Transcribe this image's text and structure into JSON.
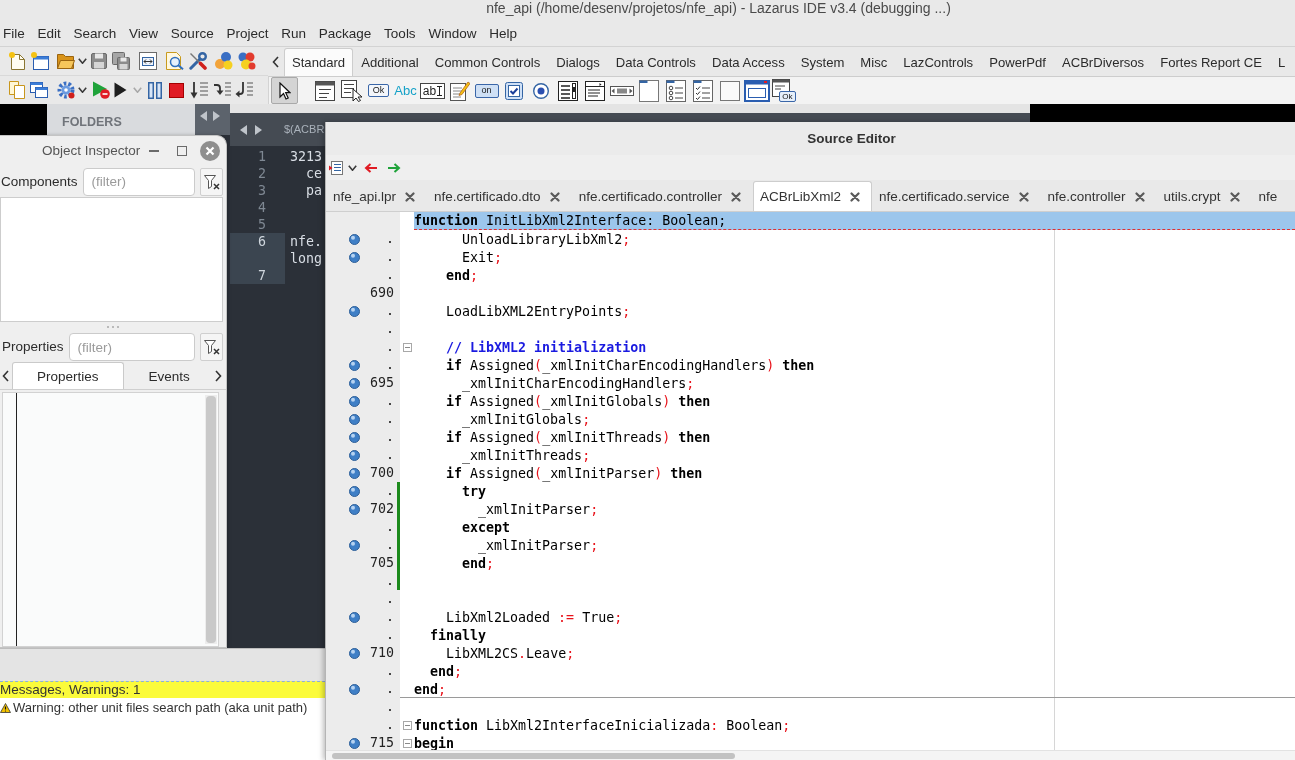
{
  "window": {
    "title": "nfe_api (/home/desenv/projetos/nfe_api) - Lazarus IDE v3.4 (debugging ...)"
  },
  "menu": [
    "File",
    "Edit",
    "Search",
    "View",
    "Source",
    "Project",
    "Run",
    "Package",
    "Tools",
    "Window",
    "Help"
  ],
  "palette": {
    "tabs": [
      {
        "label": "Standard",
        "selected": true
      },
      {
        "label": "Additional",
        "selected": false
      },
      {
        "label": "Common Controls",
        "selected": false
      },
      {
        "label": "Dialogs",
        "selected": false
      },
      {
        "label": "Data Controls",
        "selected": false
      },
      {
        "label": "Data Access",
        "selected": false
      },
      {
        "label": "System",
        "selected": false
      },
      {
        "label": "Misc",
        "selected": false
      },
      {
        "label": "LazControls",
        "selected": false
      },
      {
        "label": "PowerPdf",
        "selected": false
      },
      {
        "label": "ACBrDiversos",
        "selected": false
      },
      {
        "label": "Fortes Report CE",
        "selected": false
      },
      {
        "label": "L",
        "selected": false
      }
    ],
    "components": [
      {
        "kind": "pointer",
        "selected": true
      },
      {
        "kind": "main-menu",
        "selected": false
      },
      {
        "kind": "popup-menu",
        "selected": false
      },
      {
        "kind": "button",
        "text": "Ok",
        "selected": false
      },
      {
        "kind": "label",
        "text": "Abc",
        "selected": false
      },
      {
        "kind": "edit",
        "text": "ab",
        "selected": false
      },
      {
        "kind": "memo",
        "selected": false
      },
      {
        "kind": "toggle",
        "text": "on",
        "selected": false
      },
      {
        "kind": "checkbox",
        "selected": false
      },
      {
        "kind": "radio",
        "selected": false
      },
      {
        "kind": "listbox",
        "selected": false
      },
      {
        "kind": "combobox",
        "selected": false
      },
      {
        "kind": "scrollbar",
        "selected": false
      },
      {
        "kind": "groupbox",
        "selected": false
      },
      {
        "kind": "radiogroup",
        "selected": false
      },
      {
        "kind": "checkgroup",
        "selected": false
      },
      {
        "kind": "panel",
        "selected": false
      },
      {
        "kind": "frame",
        "selected": false
      },
      {
        "kind": "action-list",
        "text": "Ok",
        "selected": false
      }
    ]
  },
  "background_editor": {
    "sidebar_title": "FOLDERS",
    "tab": "$(ACBR",
    "lines": [
      {
        "number": "1",
        "text": "3213",
        "current": false
      },
      {
        "number": "2",
        "text": "  ce",
        "current": false
      },
      {
        "number": "3",
        "text": "  pa",
        "current": false
      },
      {
        "number": "4",
        "current": false
      },
      {
        "number": "5",
        "current": false
      },
      {
        "number": "6",
        "text": "nfe.",
        "current": true
      },
      {
        "text": "long",
        "current": true
      },
      {
        "number": "7",
        "current": true
      }
    ]
  },
  "object_inspector": {
    "title": "Object Inspector",
    "components": {
      "label": "Components",
      "placeholder": "(filter)"
    },
    "properties": {
      "label": "Properties",
      "placeholder": "(filter)"
    },
    "tabs": [
      {
        "label": "Properties",
        "selected": true
      },
      {
        "label": "Events",
        "selected": false
      }
    ]
  },
  "messages": {
    "group": "Messages, Warnings: 1",
    "items": [
      {
        "kind": "warning",
        "text": "Warning: other unit files search path (aka unit path)"
      }
    ]
  },
  "source_editor": {
    "title": "Source Editor",
    "tabs": [
      {
        "label": "nfe_api.lpr",
        "selected": false,
        "closable": true
      },
      {
        "label": "nfe.certificado.dto",
        "selected": false,
        "closable": true
      },
      {
        "label": "nfe.certificado.controller",
        "selected": false,
        "closable": true
      },
      {
        "label": "ACBrLibXml2",
        "selected": true,
        "closable": true
      },
      {
        "label": "nfe.certificado.service",
        "selected": false,
        "closable": true
      },
      {
        "label": "nfe.controller",
        "selected": false,
        "closable": true
      },
      {
        "label": "utils.crypt",
        "selected": false,
        "closable": true
      },
      {
        "label": "nfe",
        "selected": false,
        "closable": false
      }
    ],
    "lines": [
      {
        "highlighted": true,
        "marker": false,
        "modified": false,
        "divider": false,
        "fold": false,
        "tokens": [
          {
            "kind": "keyword",
            "text": "function"
          },
          {
            "kind": "identifier",
            "text": " InitLibXml2Interface"
          },
          {
            "kind": "symbol",
            "text": ":"
          },
          {
            "kind": "identifier",
            "text": " Boolean"
          },
          {
            "kind": "symbol",
            "text": ";"
          }
        ]
      },
      {
        "number": ".",
        "highlighted": false,
        "marker": true,
        "modified": false,
        "divider": false,
        "fold": false,
        "tokens": [
          {
            "kind": "identifier",
            "text": "      UnloadLibraryLibXml2"
          },
          {
            "kind": "symbol",
            "text": ";"
          }
        ]
      },
      {
        "number": ".",
        "highlighted": false,
        "marker": true,
        "modified": false,
        "divider": false,
        "fold": false,
        "tokens": [
          {
            "kind": "identifier",
            "text": "      Exit"
          },
          {
            "kind": "symbol",
            "text": ";"
          }
        ]
      },
      {
        "number": ".",
        "highlighted": false,
        "marker": false,
        "modified": false,
        "divider": false,
        "fold": false,
        "tokens": [
          {
            "kind": "keyword",
            "text": "    end"
          },
          {
            "kind": "symbol",
            "text": ";"
          }
        ]
      },
      {
        "number": "690",
        "highlighted": false,
        "marker": false,
        "modified": false,
        "divider": false,
        "fold": false
      },
      {
        "number": ".",
        "highlighted": false,
        "marker": true,
        "modified": false,
        "divider": false,
        "fold": false,
        "tokens": [
          {
            "kind": "identifier",
            "text": "    LoadLibXML2EntryPoints"
          },
          {
            "kind": "symbol",
            "text": ";"
          }
        ]
      },
      {
        "number": ".",
        "highlighted": false,
        "marker": false,
        "modified": false,
        "divider": false,
        "fold": false
      },
      {
        "number": ".",
        "highlighted": false,
        "marker": false,
        "modified": false,
        "divider": false,
        "fold": true,
        "tokens": [
          {
            "kind": "comment",
            "text": "    // LibXML2 initialization"
          }
        ]
      },
      {
        "number": ".",
        "highlighted": false,
        "marker": true,
        "modified": false,
        "divider": false,
        "fold": false,
        "tokens": [
          {
            "kind": "keyword",
            "text": "    if"
          },
          {
            "kind": "identifier",
            "text": " Assigned"
          },
          {
            "kind": "symbol",
            "text": "("
          },
          {
            "kind": "identifier",
            "text": "_xmlInitCharEncodingHandlers"
          },
          {
            "kind": "symbol",
            "text": ")"
          },
          {
            "kind": "keyword",
            "text": " then"
          }
        ]
      },
      {
        "number": "695",
        "highlighted": false,
        "marker": true,
        "modified": false,
        "divider": false,
        "fold": false,
        "tokens": [
          {
            "kind": "identifier",
            "text": "      _xmlInitCharEncodingHandlers"
          },
          {
            "kind": "symbol",
            "text": ";"
          }
        ]
      },
      {
        "number": ".",
        "highlighted": false,
        "marker": true,
        "modified": false,
        "divider": false,
        "fold": false,
        "tokens": [
          {
            "kind": "keyword",
            "text": "    if"
          },
          {
            "kind": "identifier",
            "text": " Assigned"
          },
          {
            "kind": "symbol",
            "text": "("
          },
          {
            "kind": "identifier",
            "text": "_xmlInitGlobals"
          },
          {
            "kind": "symbol",
            "text": ")"
          },
          {
            "kind": "keyword",
            "text": " then"
          }
        ]
      },
      {
        "number": ".",
        "highlighted": false,
        "marker": true,
        "modified": false,
        "divider": false,
        "fold": false,
        "tokens": [
          {
            "kind": "identifier",
            "text": "      _xmlInitGlobals"
          },
          {
            "kind": "symbol",
            "text": ";"
          }
        ]
      },
      {
        "number": ".",
        "highlighted": false,
        "marker": true,
        "modified": false,
        "divider": false,
        "fold": false,
        "tokens": [
          {
            "kind": "keyword",
            "text": "    if"
          },
          {
            "kind": "identifier",
            "text": " Assigned"
          },
          {
            "kind": "symbol",
            "text": "("
          },
          {
            "kind": "identifier",
            "text": "_xmlInitThreads"
          },
          {
            "kind": "symbol",
            "text": ")"
          },
          {
            "kind": "keyword",
            "text": " then"
          }
        ]
      },
      {
        "number": ".",
        "highlighted": false,
        "marker": true,
        "modified": false,
        "divider": false,
        "fold": false,
        "tokens": [
          {
            "kind": "identifier",
            "text": "      _xmlInitThreads"
          },
          {
            "kind": "symbol",
            "text": ";"
          }
        ]
      },
      {
        "number": "700",
        "highlighted": false,
        "marker": true,
        "modified": false,
        "divider": false,
        "fold": false,
        "tokens": [
          {
            "kind": "keyword",
            "text": "    if"
          },
          {
            "kind": "identifier",
            "text": " Assigned"
          },
          {
            "kind": "symbol",
            "text": "("
          },
          {
            "kind": "identifier",
            "text": "_xmlInitParser"
          },
          {
            "kind": "symbol",
            "text": ")"
          },
          {
            "kind": "keyword",
            "text": " then"
          }
        ]
      },
      {
        "number": ".",
        "highlighted": false,
        "marker": true,
        "modified": true,
        "divider": false,
        "fold": false,
        "tokens": [
          {
            "kind": "keyword",
            "text": "      try"
          }
        ]
      },
      {
        "number": "702",
        "highlighted": false,
        "marker": true,
        "modified": true,
        "divider": false,
        "fold": false,
        "tokens": [
          {
            "kind": "identifier",
            "text": "        _xmlInitParser"
          },
          {
            "kind": "symbol",
            "text": ";"
          }
        ]
      },
      {
        "number": ".",
        "highlighted": false,
        "marker": false,
        "modified": true,
        "divider": false,
        "fold": false,
        "tokens": [
          {
            "kind": "keyword",
            "text": "      except"
          }
        ]
      },
      {
        "number": ".",
        "highlighted": false,
        "marker": true,
        "modified": true,
        "divider": false,
        "fold": false,
        "tokens": [
          {
            "kind": "identifier",
            "text": "        _xmlInitParser"
          },
          {
            "kind": "symbol",
            "text": ";"
          }
        ]
      },
      {
        "number": "705",
        "highlighted": false,
        "marker": false,
        "modified": true,
        "divider": false,
        "fold": false,
        "tokens": [
          {
            "kind": "keyword",
            "text": "      end"
          },
          {
            "kind": "symbol",
            "text": ";"
          }
        ]
      },
      {
        "number": ".",
        "highlighted": false,
        "marker": false,
        "modified": true,
        "divider": false,
        "fold": false
      },
      {
        "number": ".",
        "highlighted": false,
        "marker": false,
        "modified": false,
        "divider": false,
        "fold": false
      },
      {
        "number": ".",
        "highlighted": false,
        "marker": true,
        "modified": false,
        "divider": false,
        "fold": false,
        "tokens": [
          {
            "kind": "identifier",
            "text": "    LibXml2Loaded "
          },
          {
            "kind": "symbol",
            "text": ":="
          },
          {
            "kind": "identifier",
            "text": " True"
          },
          {
            "kind": "symbol",
            "text": ";"
          }
        ]
      },
      {
        "number": ".",
        "highlighted": false,
        "marker": false,
        "modified": false,
        "divider": false,
        "fold": false,
        "tokens": [
          {
            "kind": "keyword",
            "text": "  finally"
          }
        ]
      },
      {
        "number": "710",
        "highlighted": false,
        "marker": true,
        "modified": false,
        "divider": false,
        "fold": false,
        "tokens": [
          {
            "kind": "identifier",
            "text": "    LibXML2CS"
          },
          {
            "kind": "symbol",
            "text": "."
          },
          {
            "kind": "identifier",
            "text": "Leave"
          },
          {
            "kind": "symbol",
            "text": ";"
          }
        ]
      },
      {
        "number": ".",
        "highlighted": false,
        "marker": false,
        "modified": false,
        "divider": false,
        "fold": false,
        "tokens": [
          {
            "kind": "keyword",
            "text": "  end"
          },
          {
            "kind": "symbol",
            "text": ";"
          }
        ]
      },
      {
        "number": ".",
        "highlighted": false,
        "marker": true,
        "modified": false,
        "divider": true,
        "fold": false,
        "tokens": [
          {
            "kind": "keyword",
            "text": "end"
          },
          {
            "kind": "symbol",
            "text": ";"
          }
        ]
      },
      {
        "number": ".",
        "highlighted": false,
        "marker": false,
        "modified": false,
        "divider": false,
        "fold": false
      },
      {
        "number": ".",
        "highlighted": false,
        "marker": false,
        "modified": false,
        "divider": false,
        "fold": true,
        "tokens": [
          {
            "kind": "keyword",
            "text": "function"
          },
          {
            "kind": "identifier",
            "text": " LibXml2InterfaceInicializada"
          },
          {
            "kind": "symbol",
            "text": ":"
          },
          {
            "kind": "identifier",
            "text": " Boolean"
          },
          {
            "kind": "symbol",
            "text": ";"
          }
        ]
      },
      {
        "number": "715",
        "highlighted": false,
        "marker": true,
        "modified": false,
        "divider": false,
        "fold": true,
        "tokens": [
          {
            "kind": "keyword",
            "text": "begin"
          }
        ]
      }
    ]
  }
}
